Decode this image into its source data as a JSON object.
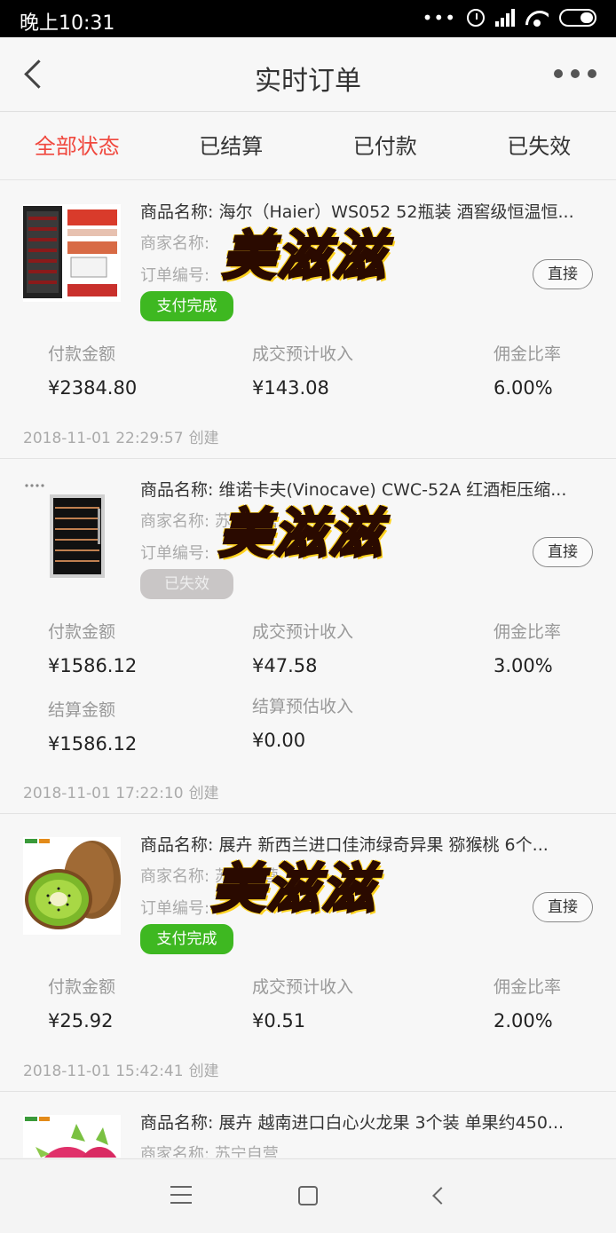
{
  "status_bar": {
    "time": "晚上10:31",
    "dots": "•••"
  },
  "nav": {
    "title": "实时订单"
  },
  "tabs": [
    {
      "label": "全部状态",
      "active": true
    },
    {
      "label": "已结算",
      "active": false
    },
    {
      "label": "已付款",
      "active": false
    },
    {
      "label": "已失效",
      "active": false
    }
  ],
  "common": {
    "direct_label": "直接",
    "created_word": "创建",
    "watermark": "美滋滋",
    "labels": {
      "pay_amount": "付款金额",
      "est_income": "成交预计收入",
      "commission_rate": "佣金比率",
      "settle_amount": "结算金额",
      "settle_est_income": "结算预估收入"
    }
  },
  "orders": [
    {
      "product_name": "商品名称: 海尔（Haier）WS052 52瓶装 酒窖级恒温恒...",
      "merchant": "商家名称: ",
      "order_no": "订单编号: ",
      "status": "支付完成",
      "status_color": "#3eb821",
      "pay_amount": "¥2384.80",
      "est_income": "¥143.08",
      "commission_rate": "6.00%",
      "created_at": "2018-11-01 22:29:57"
    },
    {
      "product_name": "商品名称: 维诺卡夫(Vinocave) CWC-52A 红酒柜压缩...",
      "merchant": "商家名称: 苏宁自营",
      "order_no": "订单编号: ",
      "status": "已失效",
      "status_color": "#c9c6c6",
      "pay_amount": "¥1586.12",
      "est_income": "¥47.58",
      "commission_rate": "3.00%",
      "settle_amount": "¥1586.12",
      "settle_est_income": "¥0.00",
      "created_at": "2018-11-01 17:22:10"
    },
    {
      "product_name": "商品名称: 展卉 新西兰进口佳沛绿奇异果 猕猴桃 6个...",
      "merchant": "商家名称: 苏宁自营",
      "order_no": "订单编号: ",
      "status": "支付完成",
      "status_color": "#3eb821",
      "pay_amount": "¥25.92",
      "est_income": "¥0.51",
      "commission_rate": "2.00%",
      "created_at": "2018-11-01 15:42:41"
    },
    {
      "product_name": "商品名称: 展卉 越南进口白心火龙果 3个装 单果约450...",
      "merchant": "商家名称: 苏宁自营"
    }
  ]
}
